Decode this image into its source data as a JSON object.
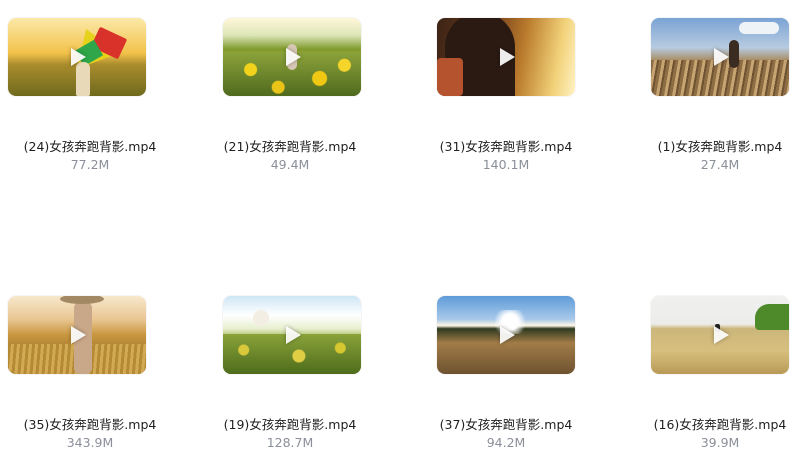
{
  "videos": [
    {
      "name": "(24)女孩奔跑背影.mp4",
      "size": "77.2M"
    },
    {
      "name": "(21)女孩奔跑背影.mp4",
      "size": "49.4M"
    },
    {
      "name": "(31)女孩奔跑背影.mp4",
      "size": "140.1M"
    },
    {
      "name": "(1)女孩奔跑背影.mp4",
      "size": "27.4M"
    },
    {
      "name": "(35)女孩奔跑背影.mp4",
      "size": "343.9M"
    },
    {
      "name": "(19)女孩奔跑背影.mp4",
      "size": "128.7M"
    },
    {
      "name": "(37)女孩奔跑背影.mp4",
      "size": "94.2M"
    },
    {
      "name": "(16)女孩奔跑背影.mp4",
      "size": "39.9M"
    }
  ],
  "icons": {
    "play": "play-icon"
  }
}
